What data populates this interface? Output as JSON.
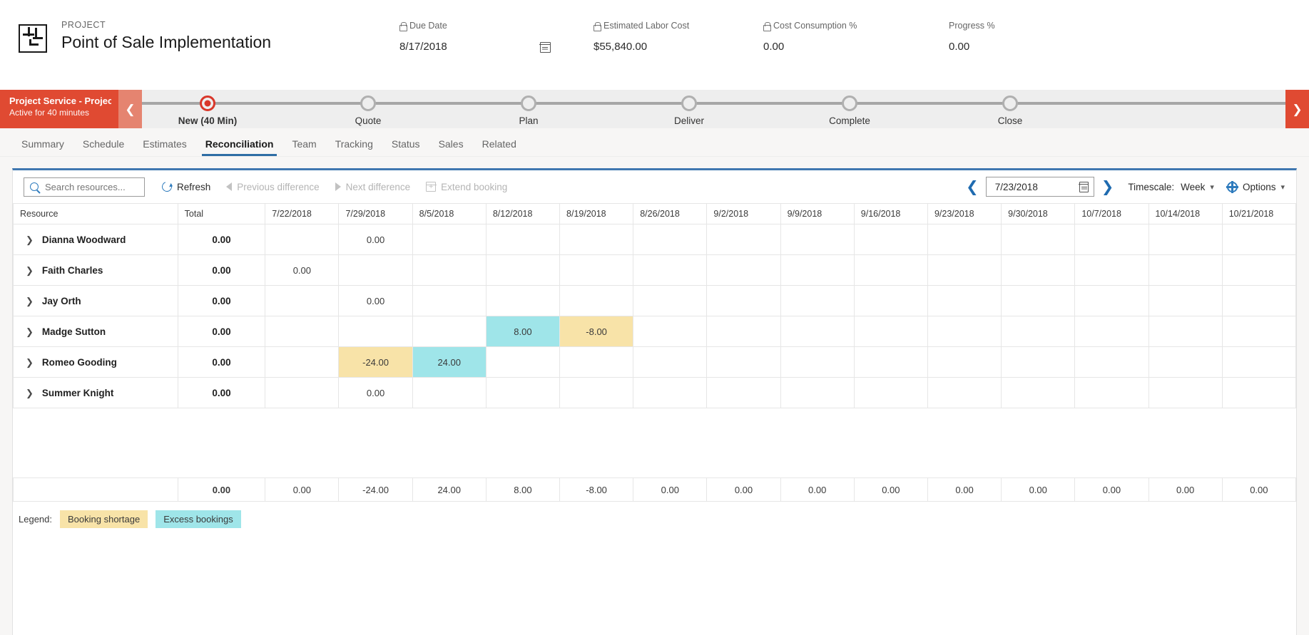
{
  "header": {
    "eyebrow": "PROJECT",
    "title": "Point of Sale Implementation",
    "entity_icon": "project-icon",
    "fields": [
      {
        "label": "Due Date",
        "value": "8/17/2018",
        "locked": true,
        "has_calendar": true
      },
      {
        "label": "Estimated Labor Cost",
        "value": "$55,840.00",
        "locked": true,
        "has_calendar": false
      },
      {
        "label": "Cost Consumption %",
        "value": "0.00",
        "locked": true,
        "has_calendar": false
      },
      {
        "label": "Progress %",
        "value": "0.00",
        "locked": false,
        "has_calendar": false
      }
    ]
  },
  "process_flow": {
    "chip_title": "Project Service - Project ...",
    "chip_subtitle": "Active for 40 minutes",
    "prev_icon": "chevron-left-icon",
    "next_icon": "chevron-right-icon",
    "stages": [
      {
        "label": "New  (40 Min)",
        "active": true
      },
      {
        "label": "Quote",
        "active": false
      },
      {
        "label": "Plan",
        "active": false
      },
      {
        "label": "Deliver",
        "active": false
      },
      {
        "label": "Complete",
        "active": false
      },
      {
        "label": "Close",
        "active": false
      }
    ]
  },
  "tabs": [
    {
      "label": "Summary",
      "active": false
    },
    {
      "label": "Schedule",
      "active": false
    },
    {
      "label": "Estimates",
      "active": false
    },
    {
      "label": "Reconciliation",
      "active": true
    },
    {
      "label": "Team",
      "active": false
    },
    {
      "label": "Tracking",
      "active": false
    },
    {
      "label": "Status",
      "active": false
    },
    {
      "label": "Sales",
      "active": false
    },
    {
      "label": "Related",
      "active": false
    }
  ],
  "toolbar": {
    "search_placeholder": "Search resources...",
    "search_value": "",
    "refresh_label": "Refresh",
    "previous_difference_label": "Previous difference",
    "next_difference_label": "Next difference",
    "extend_booking_label": "Extend booking",
    "date_value": "7/23/2018",
    "timescale_label": "Timescale:",
    "timescale_value": "Week",
    "options_label": "Options"
  },
  "grid": {
    "columns": [
      "Resource",
      "Total",
      "7/22/2018",
      "7/29/2018",
      "8/5/2018",
      "8/12/2018",
      "8/19/2018",
      "8/26/2018",
      "9/2/2018",
      "9/9/2018",
      "9/16/2018",
      "9/23/2018",
      "9/30/2018",
      "10/7/2018",
      "10/14/2018",
      "10/21/2018"
    ],
    "rows": [
      {
        "resource": "Dianna Woodward",
        "total": "0.00",
        "cells": [
          "",
          "0.00",
          "",
          "",
          "",
          "",
          "",
          "",
          "",
          "",
          "",
          "",
          "",
          ""
        ],
        "states": [
          "",
          "",
          "",
          "",
          "",
          "",
          "",
          "",
          "",
          "",
          "",
          "",
          "",
          ""
        ]
      },
      {
        "resource": "Faith Charles",
        "total": "0.00",
        "cells": [
          "0.00",
          "",
          "",
          "",
          "",
          "",
          "",
          "",
          "",
          "",
          "",
          "",
          "",
          ""
        ],
        "states": [
          "",
          "",
          "",
          "",
          "",
          "",
          "",
          "",
          "",
          "",
          "",
          "",
          "",
          ""
        ]
      },
      {
        "resource": "Jay Orth",
        "total": "0.00",
        "cells": [
          "",
          "0.00",
          "",
          "",
          "",
          "",
          "",
          "",
          "",
          "",
          "",
          "",
          "",
          ""
        ],
        "states": [
          "",
          "",
          "",
          "",
          "",
          "",
          "",
          "",
          "",
          "",
          "",
          "",
          "",
          ""
        ]
      },
      {
        "resource": "Madge Sutton",
        "total": "0.00",
        "cells": [
          "",
          "",
          "",
          "8.00",
          "-8.00",
          "",
          "",
          "",
          "",
          "",
          "",
          "",
          "",
          ""
        ],
        "states": [
          "",
          "",
          "",
          "excess",
          "shortage",
          "",
          "",
          "",
          "",
          "",
          "",
          "",
          "",
          ""
        ]
      },
      {
        "resource": "Romeo Gooding",
        "total": "0.00",
        "cells": [
          "",
          "-24.00",
          "24.00",
          "",
          "",
          "",
          "",
          "",
          "",
          "",
          "",
          "",
          "",
          ""
        ],
        "states": [
          "",
          "shortage",
          "excess",
          "",
          "",
          "",
          "",
          "",
          "",
          "",
          "",
          "",
          "",
          ""
        ]
      },
      {
        "resource": "Summer Knight",
        "total": "0.00",
        "cells": [
          "",
          "0.00",
          "",
          "",
          "",
          "",
          "",
          "",
          "",
          "",
          "",
          "",
          "",
          ""
        ],
        "states": [
          "",
          "",
          "",
          "",
          "",
          "",
          "",
          "",
          "",
          "",
          "",
          "",
          "",
          ""
        ]
      }
    ],
    "footer": {
      "resource": "",
      "total": "0.00",
      "cells": [
        "0.00",
        "-24.00",
        "24.00",
        "8.00",
        "-8.00",
        "0.00",
        "0.00",
        "0.00",
        "0.00",
        "0.00",
        "0.00",
        "0.00",
        "0.00",
        "0.00"
      ]
    },
    "expand_icon": "chevron-right-icon"
  },
  "legend": {
    "title": "Legend:",
    "items": [
      {
        "label": "Booking shortage",
        "color": "#f8e3a8"
      },
      {
        "label": "Excess bookings",
        "color": "#9fe5e9"
      }
    ]
  },
  "colors": {
    "accent_blue": "#2e7bbd",
    "panel_top_border": "#3f77b0",
    "process_red": "#e04a32",
    "tab_underline": "#2e6da4"
  }
}
